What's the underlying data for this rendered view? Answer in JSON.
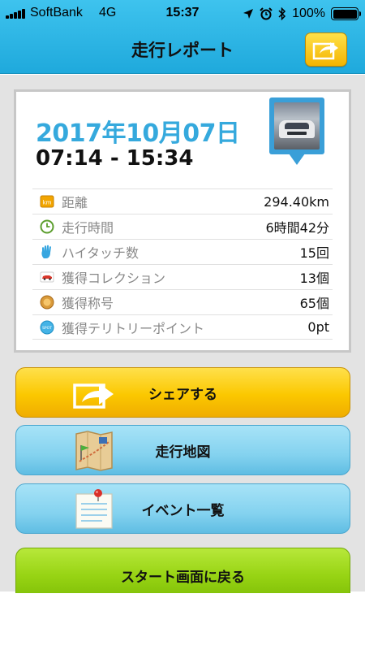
{
  "status_bar": {
    "carrier": "SoftBank",
    "network": "4G",
    "time": "15:37",
    "battery": "100%"
  },
  "header": {
    "title": "走行レポート"
  },
  "report": {
    "date": "2017年10月07日",
    "time_range": "07:14 - 15:34",
    "stats": [
      {
        "label": "距離",
        "value": "294.40km",
        "icon": "km-icon",
        "icon_text": "km"
      },
      {
        "label": "走行時間",
        "value": "6時間42分",
        "icon": "clock-icon"
      },
      {
        "label": "ハイタッチ数",
        "value": "15回",
        "icon": "hand-icon"
      },
      {
        "label": "獲得コレクション",
        "value": "13個",
        "icon": "car-icon"
      },
      {
        "label": "獲得称号",
        "value": "65個",
        "icon": "medal-icon"
      },
      {
        "label": "獲得テリトリーポイント",
        "value": "0pt",
        "icon": "spot-icon",
        "icon_text": "SPOT"
      }
    ]
  },
  "buttons": {
    "share": "シェアする",
    "map": "走行地図",
    "events": "イベント一覧",
    "back": "スタート画面に戻る"
  },
  "colors": {
    "header": "#29b6e8",
    "date": "#35a9dd",
    "share": "#fbc800",
    "blue_button": "#84d2ef",
    "green_button": "#98d414"
  }
}
